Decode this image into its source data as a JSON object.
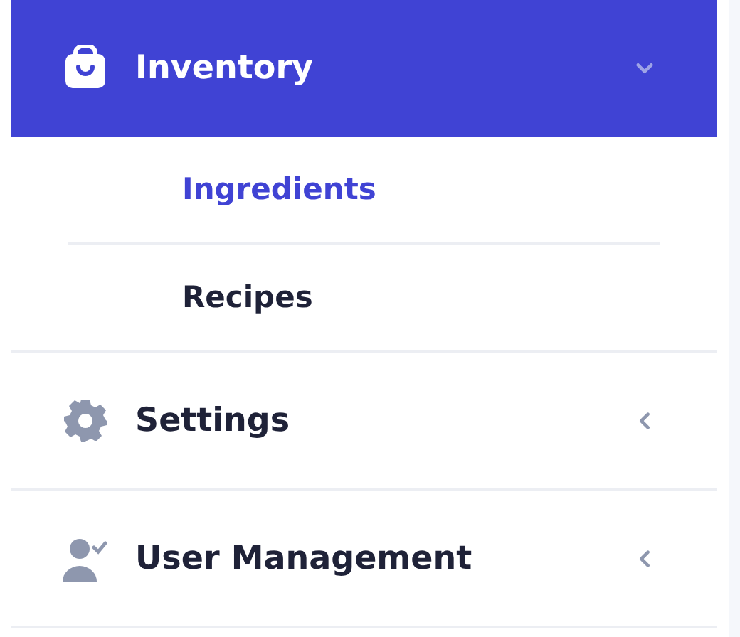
{
  "sidebar": {
    "items": [
      {
        "label": "Inventory",
        "selected": true,
        "expanded": true,
        "children": [
          {
            "label": "Ingredients",
            "selected": true
          },
          {
            "label": "Recipes",
            "selected": false
          }
        ]
      },
      {
        "label": "Settings",
        "selected": false,
        "expanded": false
      },
      {
        "label": "User Management",
        "selected": false,
        "expanded": false
      }
    ]
  }
}
